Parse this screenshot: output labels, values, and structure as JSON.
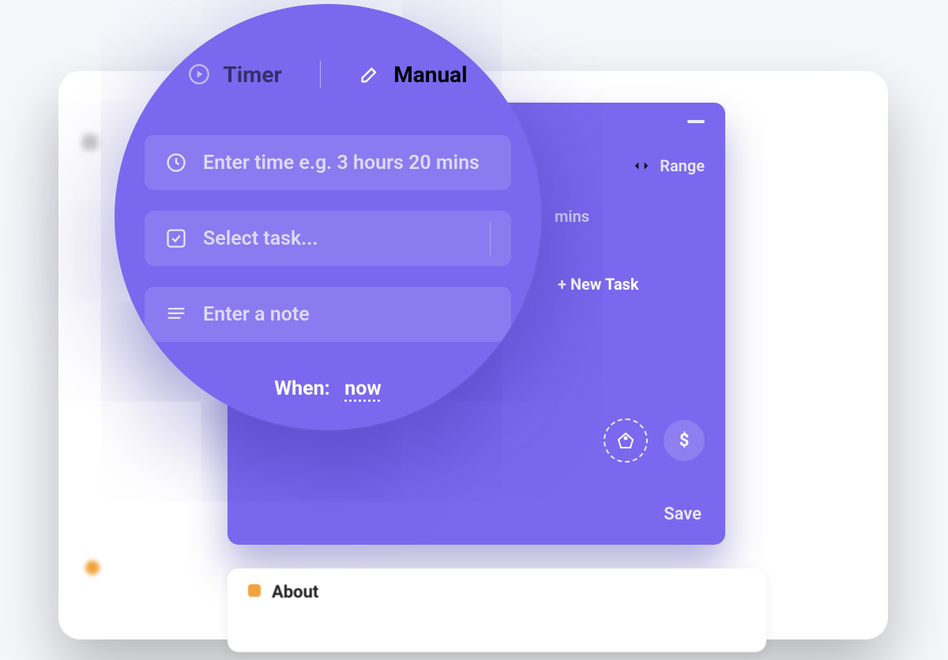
{
  "colors": {
    "accent": "#7b68ee",
    "highlight": "#f2a33c"
  },
  "tabs": {
    "timer": {
      "label": "Timer",
      "active": false
    },
    "manual": {
      "label": "Manual",
      "active": true
    }
  },
  "range_toggle_label": "Range",
  "fields": {
    "time": {
      "placeholder": "Enter time e.g. 3 hours 20 mins",
      "tail_visible": "mins"
    },
    "task": {
      "placeholder": "Select task...",
      "new_task_label": "+ New Task"
    },
    "note": {
      "placeholder": "Enter a note"
    }
  },
  "when": {
    "label": "When:",
    "value": "now"
  },
  "actions": {
    "tags_icon": "tags-icon",
    "billable_icon": "dollar-icon",
    "save_label": "Save",
    "minimize_icon": "minimize-icon"
  },
  "background_card": {
    "label": "About"
  }
}
